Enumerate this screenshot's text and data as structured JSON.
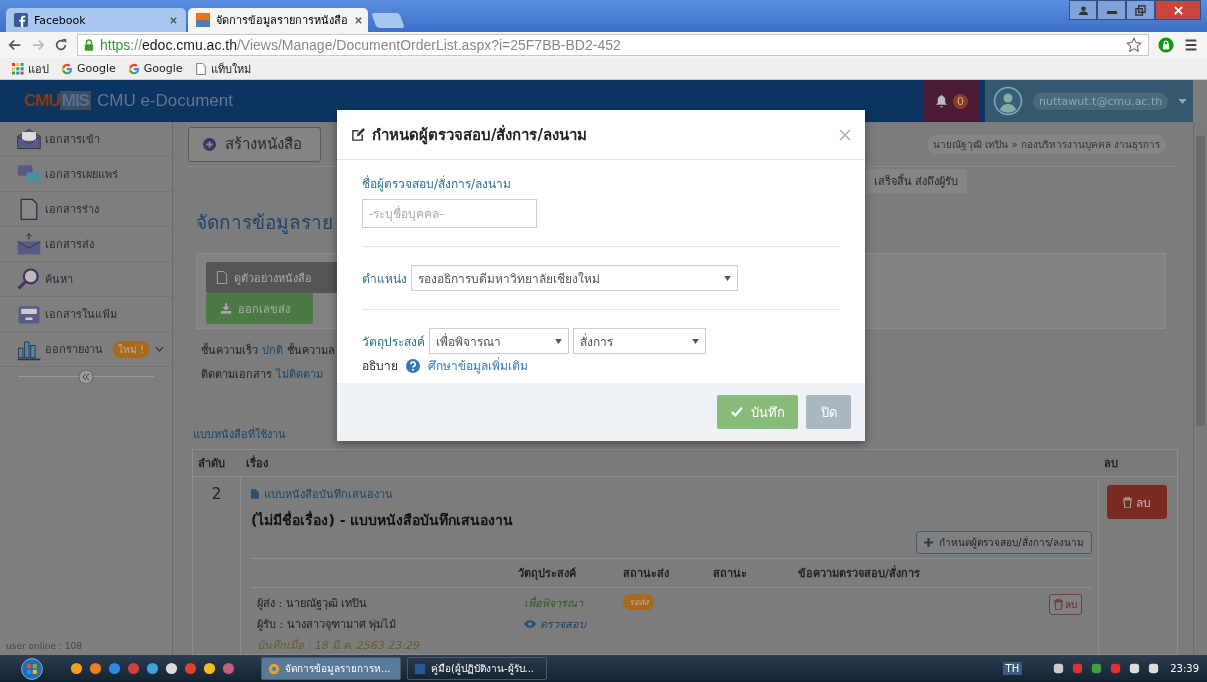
{
  "browser": {
    "tabs": [
      {
        "title": "Facebook",
        "selected": false
      },
      {
        "title": "จัดการข้อมูลรายการหนังสือ",
        "selected": true
      }
    ],
    "address": {
      "scheme": "https",
      "separator": "://",
      "host": "edoc.cmu.ac.th",
      "path": "/Views/Manage/DocumentOrderList.aspx?i=25F7BB-BD2-452"
    },
    "bookmarks": [
      "แอป",
      "Google",
      "Google",
      "แท็บใหม่"
    ]
  },
  "header": {
    "logo_left": "CMU",
    "logo_right": "MIS",
    "app_title": "CMU e-Document",
    "notifications": "0",
    "user_email": "nuttawut.t@cmu.ac.th"
  },
  "sidebar": {
    "items": [
      {
        "label": "เอกสารเข้า"
      },
      {
        "label": "เอกสารเผยแพร่"
      },
      {
        "label": "เอกสารร่าง"
      },
      {
        "label": "เอกสารส่ง"
      },
      {
        "label": "ค้นหา"
      },
      {
        "label": "เอกสารในแฟ้ม"
      },
      {
        "label": "ออกรายงาน",
        "badge": "ใหม่ !",
        "expanded": false
      }
    ],
    "user_online": "user online : 108"
  },
  "toolbar": {
    "create_button": "สร้างหนังสือ",
    "breadcrumb": "นายณัฐวุฒิ เทปิน » กองบริหารงานบุคคล งานธุรการ"
  },
  "status_tab": "เสร็จสิ้น ส่งถึงผู้รับ",
  "page_title": "จัดการข้อมูลราย",
  "actions": [
    "ดูตัวอย่างหนังสือ",
    "ออกเลขส่ง"
  ],
  "info": [
    {
      "label": "ชั้นความเร็ว",
      "value": "ปกติ",
      "rest": "ชั้นความล"
    },
    {
      "label": "ติดตามเอกสาร",
      "value": "ไม่ติดตาม"
    }
  ],
  "templates": {
    "heading": "แบบหนังสือที่ใช้งาน",
    "columns": [
      "ลำดับ",
      "เรื่อง",
      "ลบ"
    ],
    "rows": [
      {
        "order": "2",
        "template": "แบบหนังสือบันทึกเสนองาน",
        "title": "(ไม่มีชื่อเรื่อง) - แบบหนังสือบันทึกเสนองาน",
        "assign_button": "กำหนดผู้ตรวจสอบ/สั่งการ/ลงนาม",
        "delete": "ลบ",
        "sub_columns": [
          "วัตถุประสงค์",
          "สถานะส่ง",
          "สถานะ",
          "ข้อความตรวจสอบ/สั่งการ"
        ],
        "entries": [
          {
            "sender": "ผู้ส่ง : นายณัฐวุฒิ เทปิน",
            "receiver": "ผู้รับ : นางสาวจุฑามาศ พุ่มไม้",
            "saved": "บันทึกเมื่อ : 18 มี.ค. 2563 23:29",
            "purpose": "เพื่อพิจารณา",
            "review_link": "ตรวจสอบ",
            "send_status": "รอส่ง",
            "delete": "ลบ"
          }
        ]
      }
    ]
  },
  "dialog": {
    "title": "กำหนดผู้ตรวจสอบ/สั่งการ/ลงนาม",
    "name_field": {
      "label": "ชื่อผู้ตรวจสอบ/สั่งการ/ลงนาม",
      "placeholder": "-ระบุชื่อบุคคล-"
    },
    "position": {
      "label": "ตำแหน่ง",
      "value": "รองอธิการบดีมหาวิทยาลัยเชียงใหม่"
    },
    "purpose": {
      "label": "วัตถุประสงค์",
      "value": "เพื่อพิจารณา",
      "action": "สั่งการ"
    },
    "explain_label": "อธิบาย",
    "more_link": "ศึกษาข้อมูลเพิ่มเติม",
    "save_button": "บันทึก",
    "close_button": "ปิด"
  },
  "taskbar": {
    "tasks": [
      {
        "label": "จัดการข้อมูลรายการห...",
        "selected": true
      },
      {
        "label": "คู่มือ(ผู้ปฏิบัติงาน-ผู้รับ...",
        "selected": false
      }
    ],
    "language": "TH",
    "clock": "23:39"
  }
}
